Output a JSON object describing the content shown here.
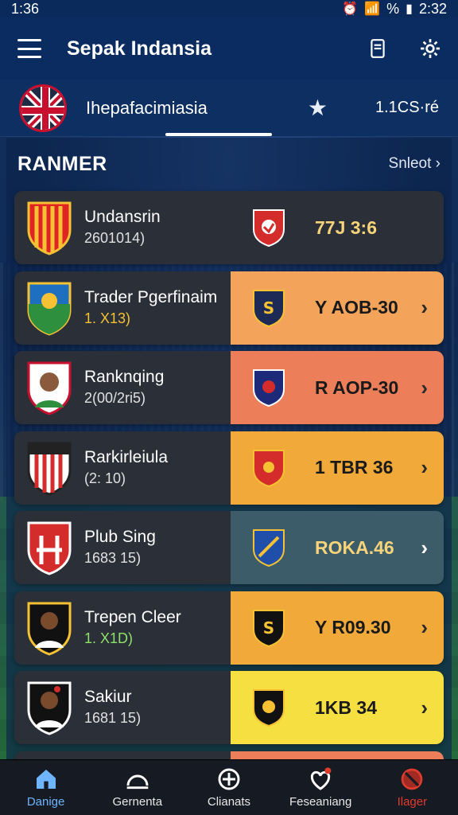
{
  "status": {
    "time": "1:36",
    "battery": "%",
    "clock": "2:32"
  },
  "app": {
    "title": "Sepak Indansia"
  },
  "tabs": {
    "league": "Ihepafacimiasia",
    "code": "1.1CS·ré"
  },
  "section": {
    "title": "RANMER",
    "link": "Snleot"
  },
  "rows": [
    {
      "name": "Undansrin",
      "sub": "2601014)",
      "score": "77J 3:6",
      "color": "#2b3038"
    },
    {
      "name": "Trader Pgerfinaim",
      "sub": "1. X13)",
      "score": "Y AOB-30",
      "color": "#f3a45a"
    },
    {
      "name": "Ranknqing",
      "sub": "2(00/2ri5)",
      "score": "R AOP-30",
      "color": "#ec7f5a"
    },
    {
      "name": "Rarkirleiula",
      "sub": "(2: 10)",
      "score": "1 TBR 36",
      "color": "#f1a93a"
    },
    {
      "name": "Plub Sing",
      "sub": "1683 15)",
      "score": "ROKA.46",
      "color": "#3b5c68"
    },
    {
      "name": "Trepen Cleer",
      "sub": "1. X1D)",
      "score": "Y R09.30",
      "color": "#f1a93a"
    },
    {
      "name": "Sakiur",
      "sub": "1681 15)",
      "score": "1KB 34",
      "color": "#f6df40"
    }
  ],
  "nav": [
    {
      "label": "Danige",
      "icon": "home-icon"
    },
    {
      "label": "Gernenta",
      "icon": "dome-icon"
    },
    {
      "label": "Clianats",
      "icon": "target-icon"
    },
    {
      "label": "Feseaniang",
      "icon": "heart-icon"
    },
    {
      "label": "Ilager",
      "icon": "ban-icon"
    }
  ]
}
